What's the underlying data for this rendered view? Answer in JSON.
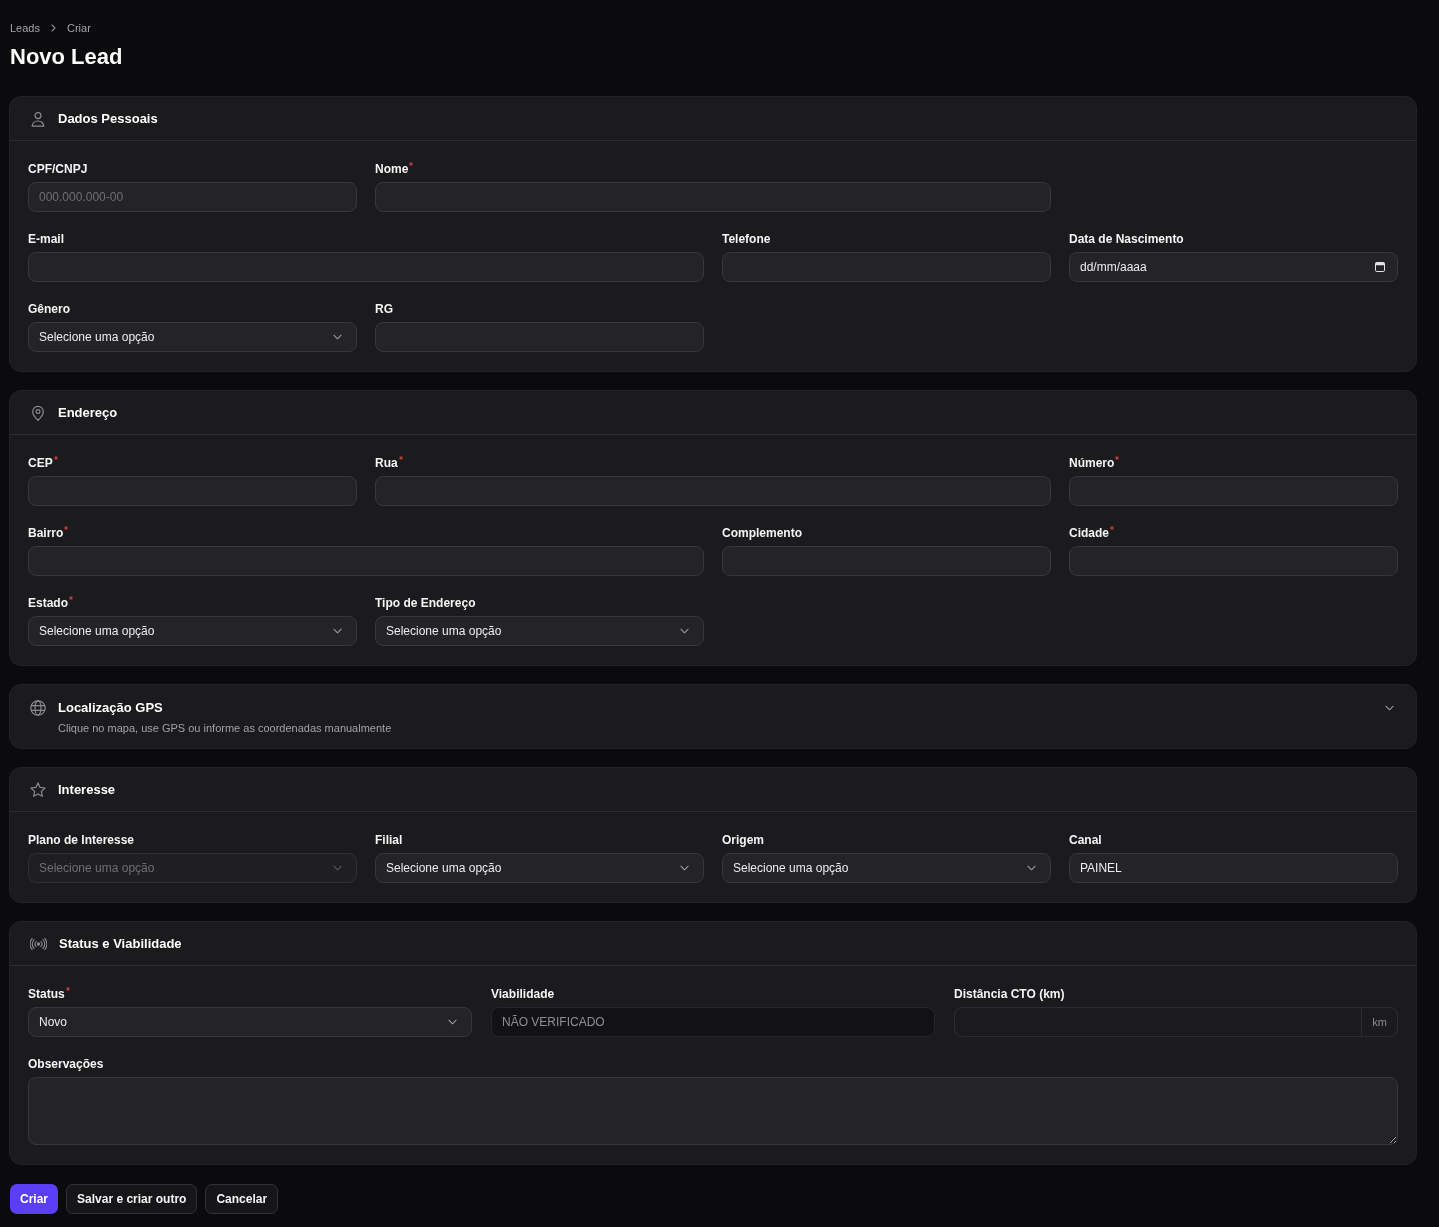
{
  "breadcrumb": [
    {
      "label": "Leads"
    },
    {
      "label": "Criar"
    }
  ],
  "title": "Novo Lead",
  "sections": [
    {
      "title": "Dados Pessoais",
      "collapsible": false,
      "expanded": true,
      "fields": [
        {
          "kind": "text",
          "label": "CPF/CNPJ",
          "required": false,
          "disabled": false,
          "placeholder": "000.000.000-00"
        },
        {
          "kind": "text",
          "label": "Nome",
          "required": true,
          "disabled": false
        },
        {
          "kind": "text",
          "label": "E-mail",
          "required": false,
          "disabled": false
        },
        {
          "kind": "text",
          "label": "Telefone",
          "required": false,
          "disabled": false
        },
        {
          "kind": "date",
          "label": "Data de Nascimento",
          "required": false,
          "disabled": false,
          "value": "dd/mm/aaaa"
        },
        {
          "kind": "select",
          "label": "Gênero",
          "required": false,
          "disabled": false,
          "value": "Selecione uma opção"
        },
        {
          "kind": "text",
          "label": "RG",
          "required": false,
          "disabled": false
        }
      ]
    },
    {
      "title": "Endereço",
      "collapsible": false,
      "expanded": true,
      "fields": [
        {
          "kind": "text",
          "label": "CEP",
          "required": true,
          "disabled": false
        },
        {
          "kind": "text",
          "label": "Rua",
          "required": true,
          "disabled": false
        },
        {
          "kind": "text",
          "label": "Número",
          "required": true,
          "disabled": false
        },
        {
          "kind": "text",
          "label": "Bairro",
          "required": true,
          "disabled": false
        },
        {
          "kind": "text",
          "label": "Complemento",
          "required": false,
          "disabled": false
        },
        {
          "kind": "text",
          "label": "Cidade",
          "required": true,
          "disabled": false
        },
        {
          "kind": "select",
          "label": "Estado",
          "required": true,
          "disabled": false,
          "value": "Selecione uma opção"
        },
        {
          "kind": "select",
          "label": "Tipo de Endereço",
          "required": false,
          "disabled": false,
          "value": "Selecione uma opção"
        }
      ]
    },
    {
      "title": "Localização GPS",
      "subtitle": "Clique no mapa, use GPS ou informe as coordenadas manualmente",
      "collapsible": true,
      "expanded": false
    },
    {
      "title": "Interesse",
      "collapsible": false,
      "expanded": true,
      "fields": [
        {
          "kind": "select",
          "label": "Plano de Interesse",
          "required": false,
          "disabled": true,
          "value": "Selecione uma opção"
        },
        {
          "kind": "select",
          "label": "Filial",
          "required": false,
          "disabled": false,
          "value": "Selecione uma opção"
        },
        {
          "kind": "select",
          "label": "Origem",
          "required": false,
          "disabled": false,
          "value": "Selecione uma opção"
        },
        {
          "kind": "text",
          "label": "Canal",
          "required": false,
          "disabled": false,
          "value": "PAINEL"
        }
      ]
    },
    {
      "title": "Status e Viabilidade",
      "collapsible": false,
      "expanded": true,
      "fields": [
        {
          "kind": "select",
          "label": "Status",
          "required": true,
          "disabled": false,
          "value": "Novo"
        },
        {
          "kind": "text",
          "label": "Viabilidade",
          "required": false,
          "disabled": true,
          "value": "NÃO VERIFICADO"
        },
        {
          "kind": "unit",
          "label": "Distância CTO (km)",
          "required": false,
          "disabled": false,
          "unit": "km"
        },
        {
          "kind": "textarea",
          "label": "Observações",
          "required": false,
          "disabled": false
        }
      ]
    }
  ],
  "buttons": [
    {
      "label": "Criar",
      "primary": true
    },
    {
      "label": "Salvar e criar outro",
      "primary": false
    },
    {
      "label": "Cancelar",
      "primary": false
    }
  ]
}
